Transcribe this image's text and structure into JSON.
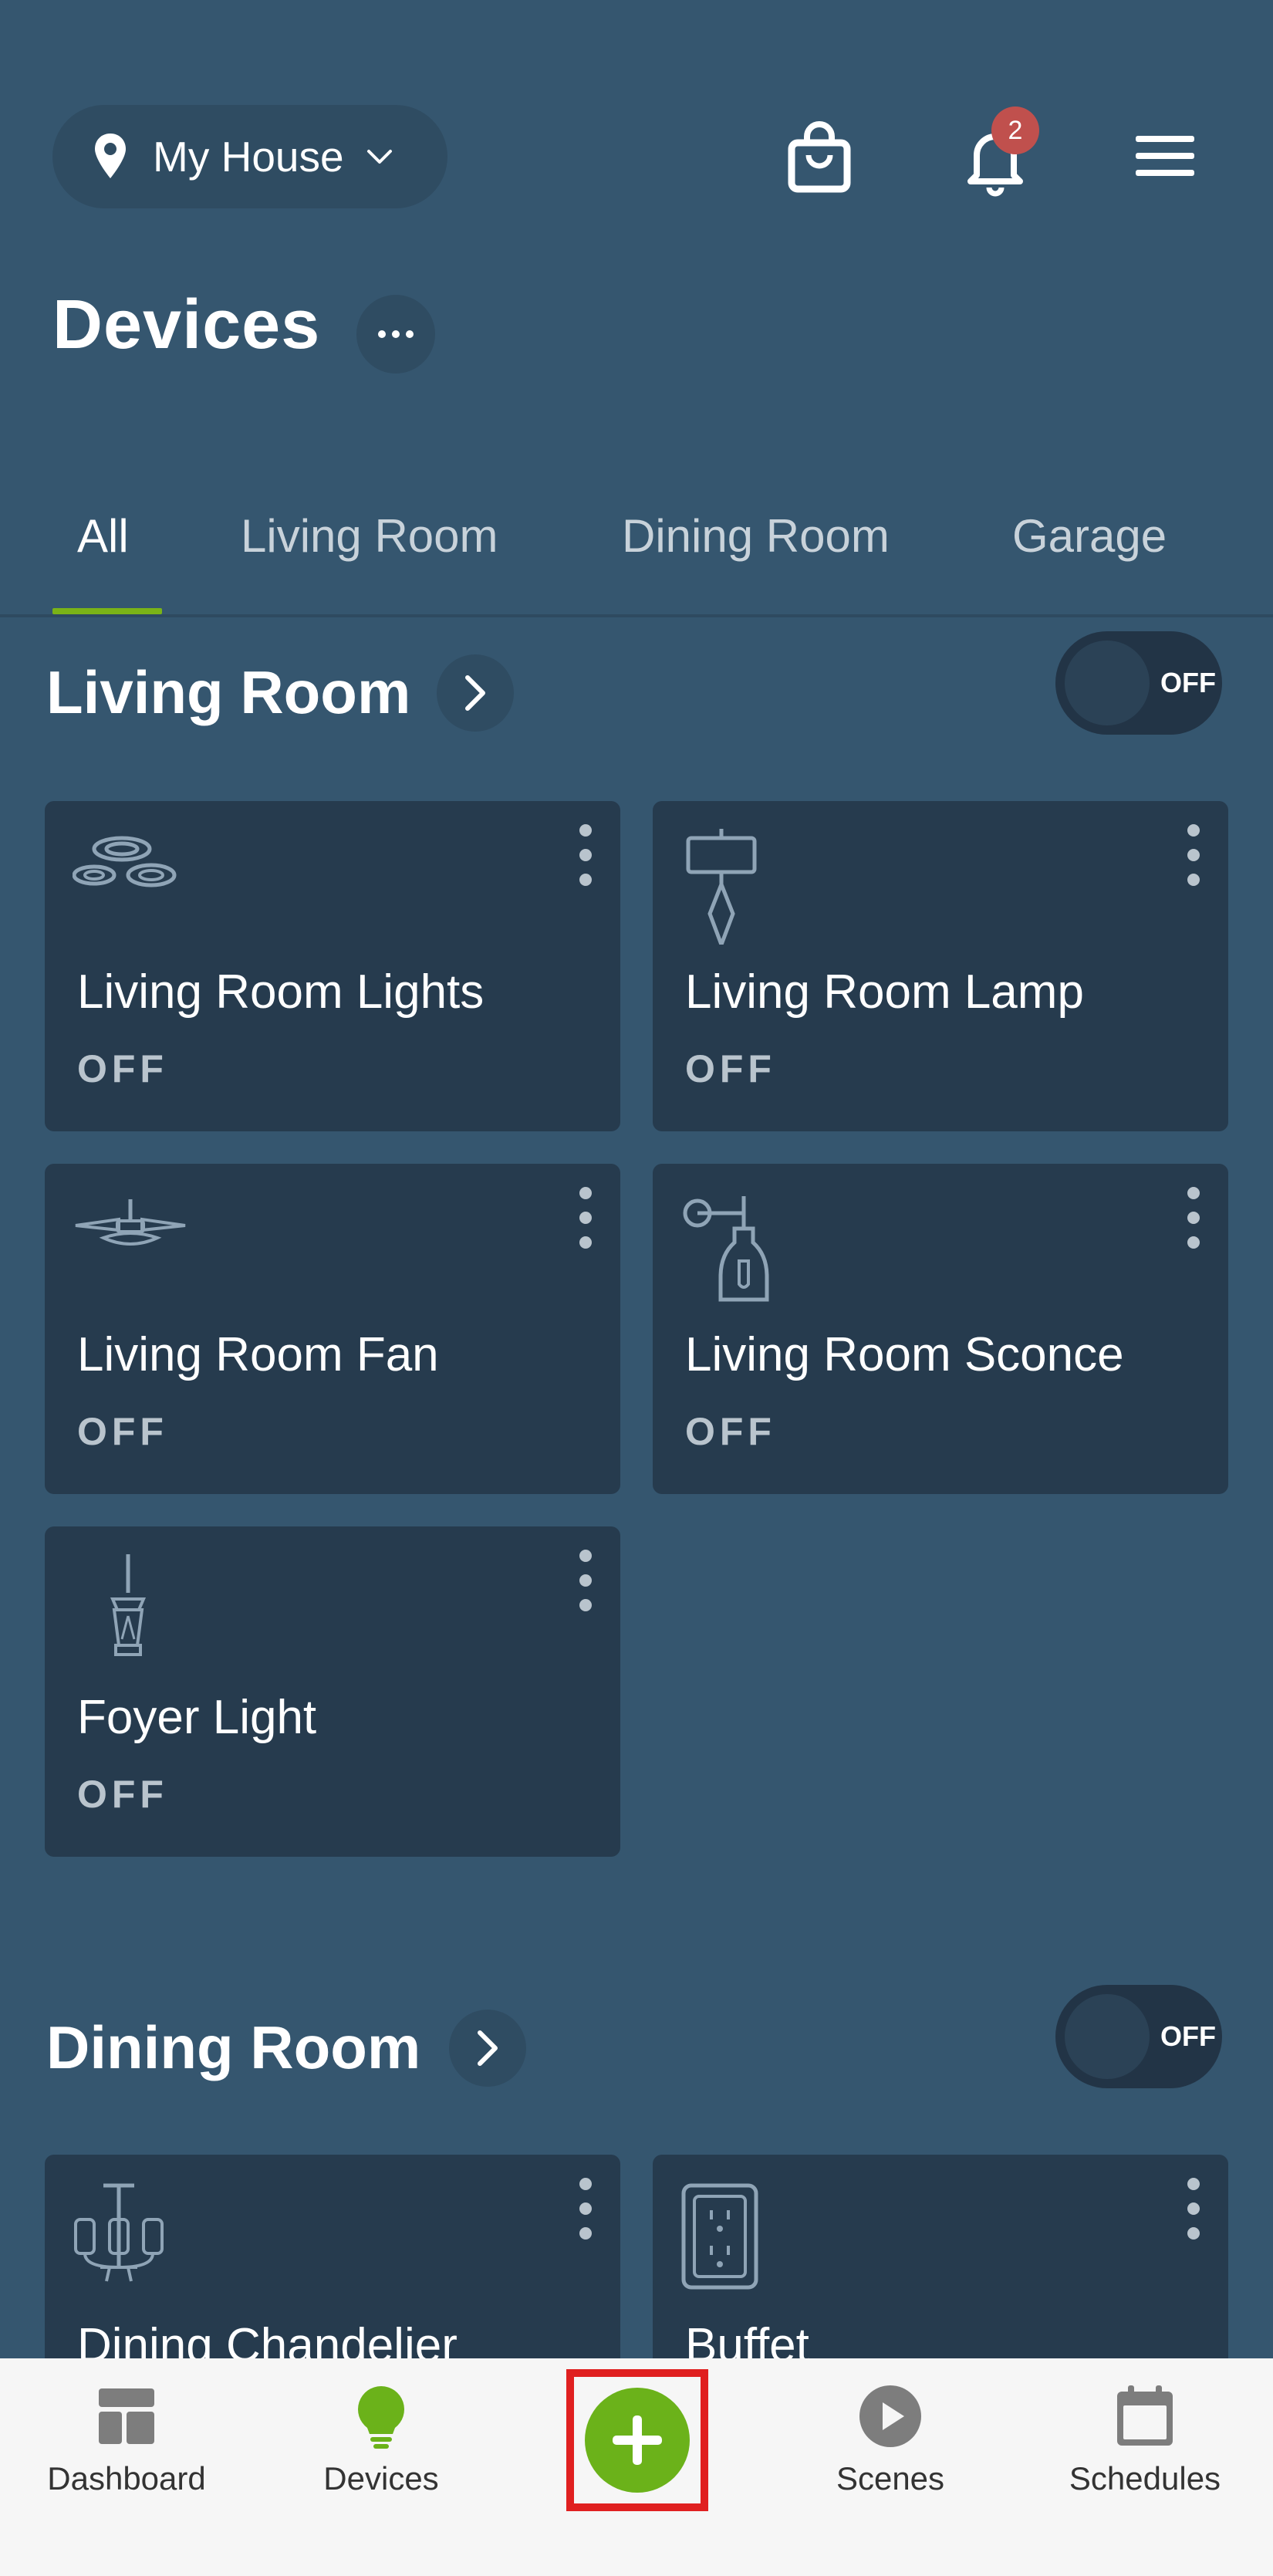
{
  "header": {
    "location_label": "My House",
    "notification_count": "2"
  },
  "page": {
    "title": "Devices"
  },
  "tabs": [
    {
      "label": "All",
      "active": true
    },
    {
      "label": "Living Room",
      "active": false
    },
    {
      "label": "Dining Room",
      "active": false
    },
    {
      "label": "Garage",
      "active": false
    }
  ],
  "sections": [
    {
      "title": "Living Room",
      "toggle_state": "OFF",
      "devices": [
        {
          "name": "Living Room Lights",
          "state": "OFF",
          "icon": "recessed-lights-icon"
        },
        {
          "name": "Living Room Lamp",
          "state": "OFF",
          "icon": "table-lamp-icon"
        },
        {
          "name": "Living Room Fan",
          "state": "OFF",
          "icon": "ceiling-fan-icon"
        },
        {
          "name": "Living Room Sconce",
          "state": "OFF",
          "icon": "wall-sconce-icon"
        },
        {
          "name": "Foyer Light",
          "state": "OFF",
          "icon": "pendant-lantern-icon"
        }
      ]
    },
    {
      "title": "Dining Room",
      "toggle_state": "OFF",
      "devices": [
        {
          "name": "Dining Chandelier",
          "icon": "chandelier-icon"
        },
        {
          "name": "Buffet",
          "icon": "outlet-icon"
        }
      ]
    }
  ],
  "bottom_nav": {
    "items": [
      {
        "label": "Dashboard",
        "icon": "dashboard-icon"
      },
      {
        "label": "Devices",
        "icon": "bulb-icon",
        "active": true
      },
      {
        "label": "Scenes",
        "icon": "play-icon"
      },
      {
        "label": "Schedules",
        "icon": "calendar-icon"
      }
    ],
    "add_icon": "plus-icon"
  },
  "colors": {
    "background": "#35566f",
    "card": "#263b4e",
    "accent": "#7ab317",
    "badge": "#c0504d",
    "highlight_frame": "#e02020"
  }
}
